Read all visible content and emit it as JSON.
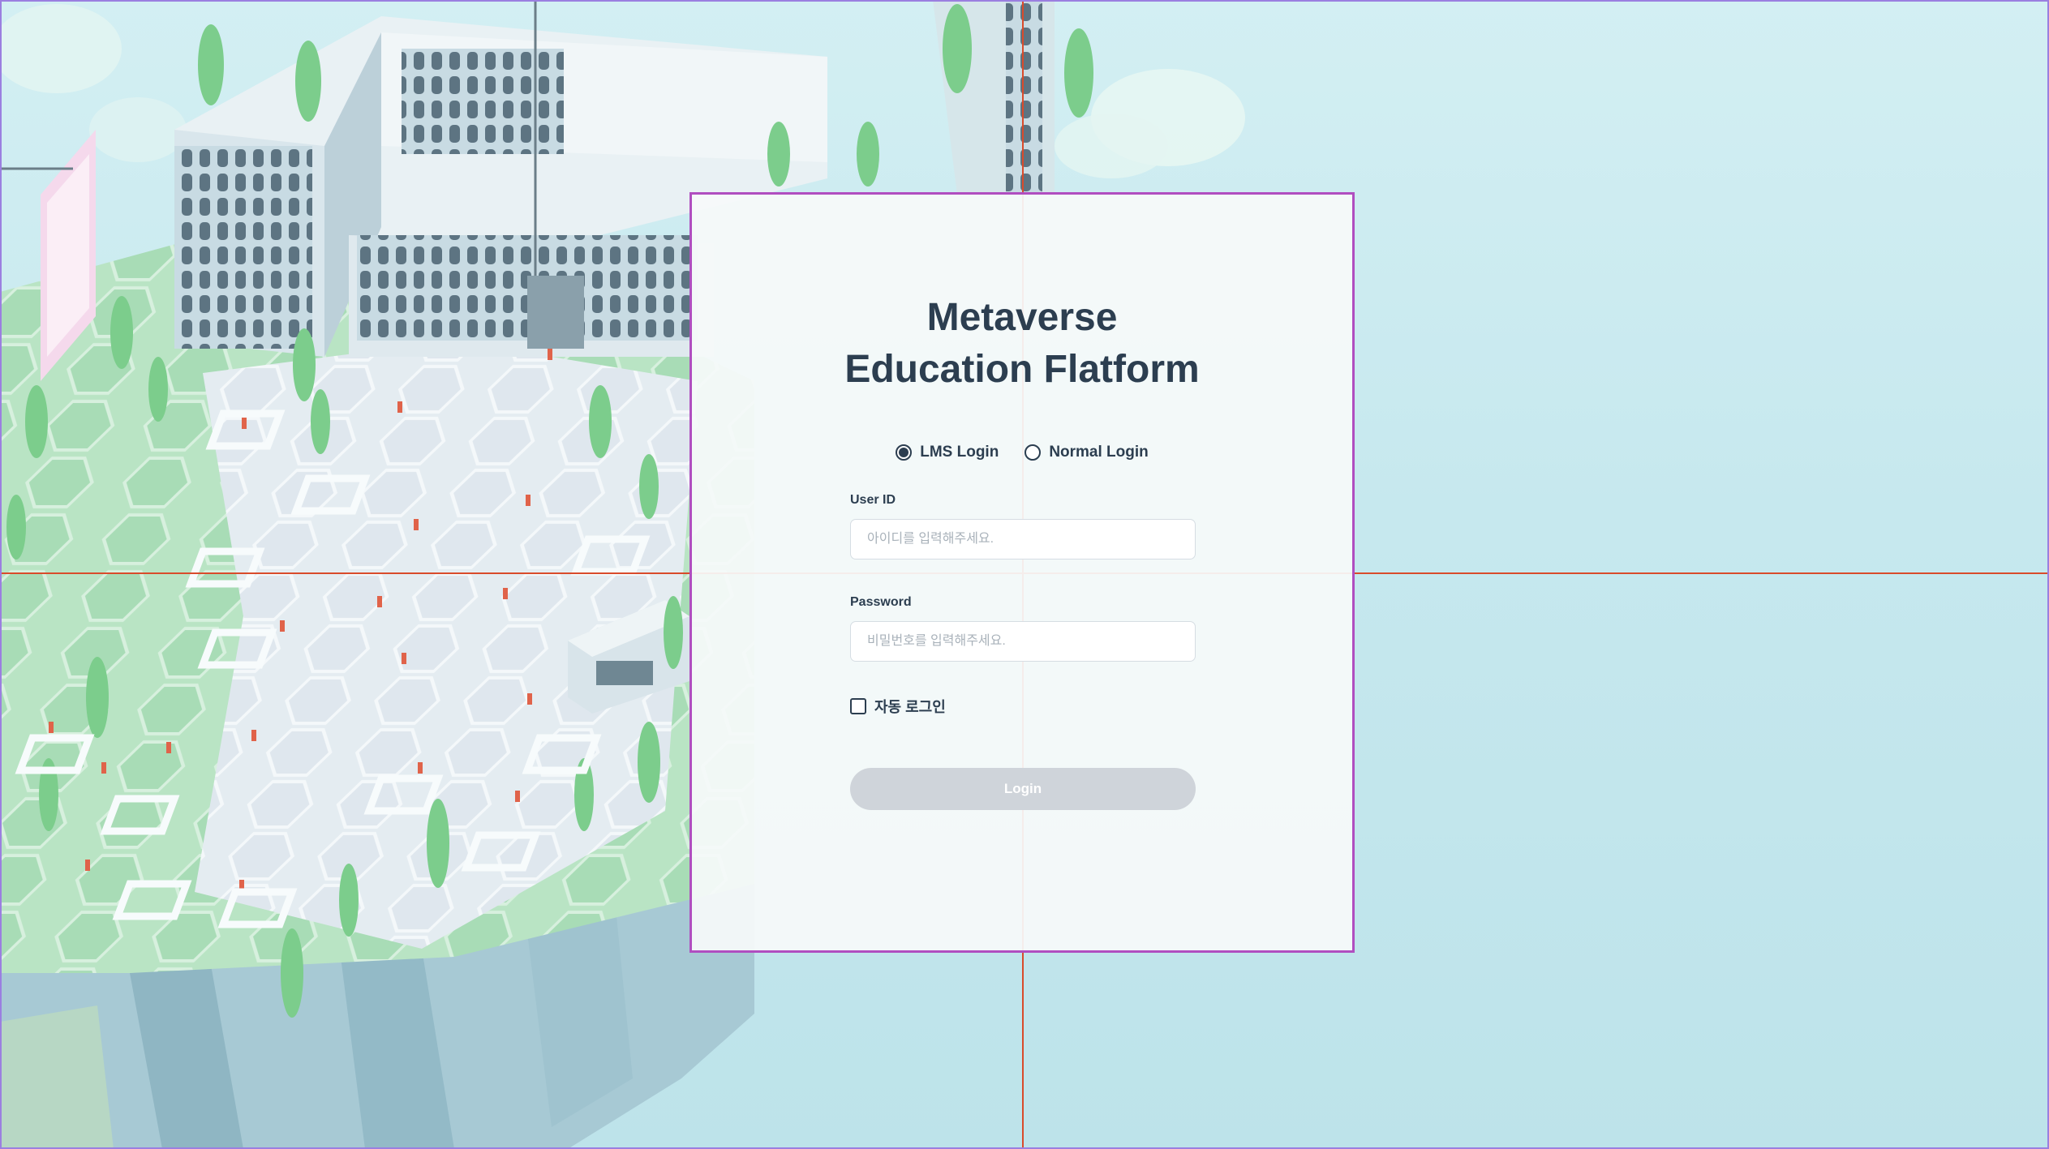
{
  "login": {
    "title_line1": "Metaverse",
    "title_line2": "Education Flatform",
    "login_types": [
      {
        "label": "LMS Login",
        "selected": true
      },
      {
        "label": "Normal Login",
        "selected": false
      }
    ],
    "user_id": {
      "label": "User ID",
      "value": "",
      "placeholder": "아이디를 입력해주세요."
    },
    "password": {
      "label": "Password",
      "value": "",
      "placeholder": "비밀번호를 입력해주세요."
    },
    "auto_login": {
      "label": "자동 로그인",
      "checked": false
    },
    "submit_label": "Login"
  },
  "colors": {
    "text": "#2c3e50",
    "card_border": "#b04ec0",
    "button_disabled": "#cfd4da",
    "guide_lines": "#d94b2b",
    "background": "#c4e8ee"
  }
}
